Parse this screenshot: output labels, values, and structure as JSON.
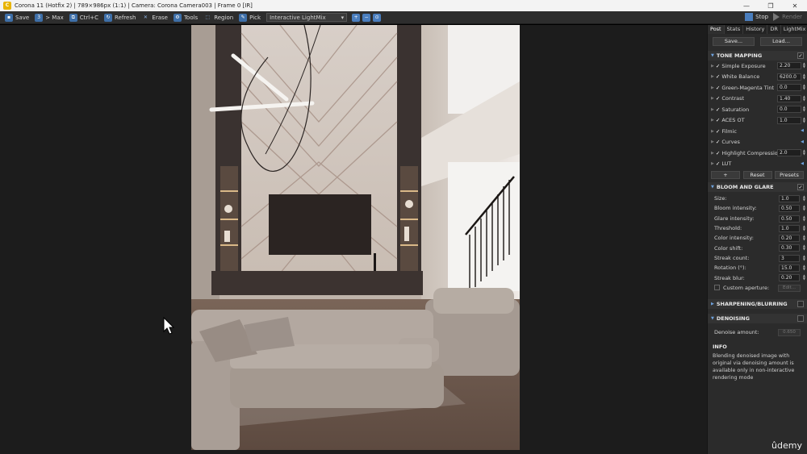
{
  "window": {
    "title": "Corona 11 (Hotfix 2) | 789×986px (1:1) | Camera: Corona Camera003 | Frame 0 [IR]",
    "app_icon": "corona-logo-icon",
    "controls": [
      "—",
      "❐",
      "✕"
    ]
  },
  "toolbar": {
    "save": "Save",
    "max": "> Max",
    "copy": "Ctrl+C",
    "refresh": "Refresh",
    "erase": "Erase",
    "tools": "Tools",
    "region": "Region",
    "pick": "Pick",
    "mode_select": "Interactive LightMix",
    "stop": "Stop",
    "render": "Render"
  },
  "panel": {
    "tabs": [
      "Post",
      "Stats",
      "History",
      "DR",
      "LightMix"
    ],
    "active_tab": "Post",
    "save_btn": "Save...",
    "load_btn": "Load...",
    "tone_mapping": {
      "title": "TONE MAPPING",
      "rows": [
        {
          "label": "Simple Exposure",
          "value": "2.20"
        },
        {
          "label": "White Balance",
          "value": "6200.0"
        },
        {
          "label": "Green-Magenta Tint",
          "value": "0.0"
        },
        {
          "label": "Contrast",
          "value": "1.40"
        },
        {
          "label": "Saturation",
          "value": "0.0"
        },
        {
          "label": "ACES OT",
          "value": "1.0"
        },
        {
          "label": "Filmic",
          "value": ""
        },
        {
          "label": "Curves",
          "value": ""
        },
        {
          "label": "Highlight Compression",
          "value": "2.0"
        },
        {
          "label": "LUT",
          "value": ""
        }
      ],
      "add_btn": "+",
      "reset_btn": "Reset",
      "presets_btn": "Presets"
    },
    "bloom_glare": {
      "title": "BLOOM AND GLARE",
      "rows": [
        {
          "label": "Size:",
          "value": "1.0"
        },
        {
          "label": "Bloom intensity:",
          "value": "0.50"
        },
        {
          "label": "Glare intensity:",
          "value": "0.50"
        },
        {
          "label": "Threshold:",
          "value": "1.0"
        },
        {
          "label": "Color intensity:",
          "value": "0.20"
        },
        {
          "label": "Color shift:",
          "value": "0.30"
        },
        {
          "label": "Streak count:",
          "value": "3"
        },
        {
          "label": "Rotation (°):",
          "value": "15.0"
        },
        {
          "label": "Streak blur:",
          "value": "0.20"
        }
      ],
      "custom_aperture": "Custom aperture:",
      "edit_btn": "Edit..."
    },
    "sharpening": {
      "title": "SHARPENING/BLURRING"
    },
    "denoising": {
      "title": "DENOISING",
      "amount_label": "Denoise amount:",
      "amount_value": "0.650"
    },
    "info": {
      "title": "INFO",
      "text": "Blending denoised image with original via denoising amount is available only in non-interactive rendering mode"
    }
  },
  "watermark": "ûdemy"
}
